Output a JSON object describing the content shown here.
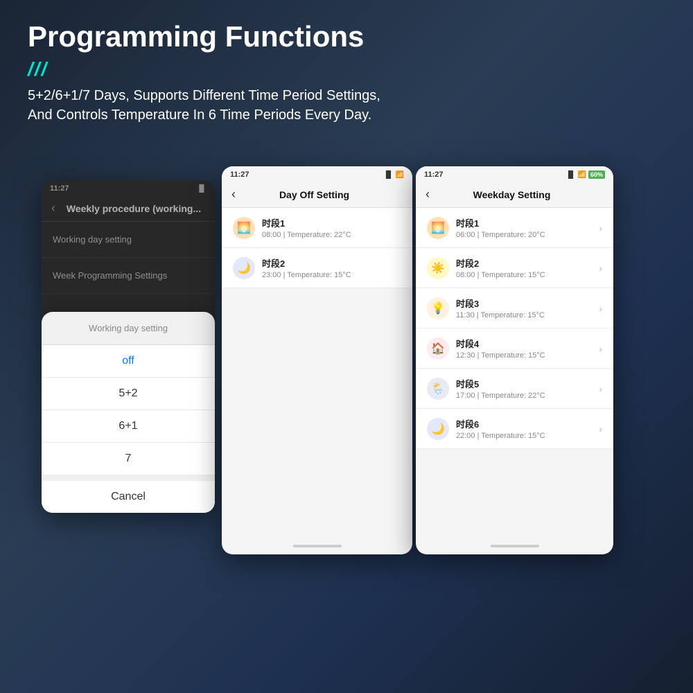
{
  "header": {
    "title": "Programming Functions",
    "accent": "///",
    "subtitle_line1": "5+2/6+1/7 Days, Supports Different Time Period Settings,",
    "subtitle_line2": "And Controls Temperature In 6 Time Periods Every Day."
  },
  "phone1": {
    "status": {
      "time": "11:27",
      "signal": "▐▌",
      "battery": ""
    },
    "nav": {
      "back": "‹",
      "title": "Weekly procedure (working..."
    },
    "menu_items": [
      {
        "label": "Working day setting"
      },
      {
        "label": "Week Programming Settings"
      }
    ],
    "bottom_sheet": {
      "title": "Working day setting",
      "options": [
        "off",
        "5+2",
        "6+1",
        "7"
      ],
      "cancel": "Cancel"
    }
  },
  "phone2": {
    "status": {
      "time": "11:27",
      "signal": "▐▌",
      "wifi": "wifi",
      "battery": ""
    },
    "nav": {
      "back": "‹",
      "title": "Day Off Setting"
    },
    "items": [
      {
        "icon": "🌅",
        "icon_bg": "#ffe0b2",
        "title": "时段1",
        "subtitle": "08:00  |  Temperature: 22°C"
      },
      {
        "icon": "🌙",
        "icon_bg": "#e3e8ff",
        "title": "时段2",
        "subtitle": "23:00  |  Temperature: 15°C"
      }
    ]
  },
  "phone3": {
    "status": {
      "time": "11:27",
      "signal": "▐▌",
      "wifi": "wifi",
      "battery": "60%"
    },
    "nav": {
      "back": "‹",
      "title": "Weekday Setting"
    },
    "items": [
      {
        "icon": "🌅",
        "icon_bg": "#ffe0b2",
        "title": "时段1",
        "subtitle": "06:00  |  Temperature: 20°C"
      },
      {
        "icon": "☀️",
        "icon_bg": "#fff9c4",
        "title": "时段2",
        "subtitle": "08:00  |  Temperature: 15°C"
      },
      {
        "icon": "💡",
        "icon_bg": "#fff3e0",
        "title": "时段3",
        "subtitle": "11:30  |  Temperature: 15°C"
      },
      {
        "icon": "🏠",
        "icon_bg": "#ffebee",
        "title": "时段4",
        "subtitle": "12:30  |  Temperature: 15°C"
      },
      {
        "icon": "🌦️",
        "icon_bg": "#e8eaf6",
        "title": "时段5",
        "subtitle": "17:00  |  Temperature: 22°C"
      },
      {
        "icon": "🌙",
        "icon_bg": "#e3e8ff",
        "title": "时段6",
        "subtitle": "22:00  |  Temperature: 15°C"
      }
    ]
  },
  "colors": {
    "accent": "#00e5cc",
    "bg_dark": "#1a2535",
    "phone_dark": "#3a3a3a",
    "phone_light": "#f5f5f5"
  }
}
